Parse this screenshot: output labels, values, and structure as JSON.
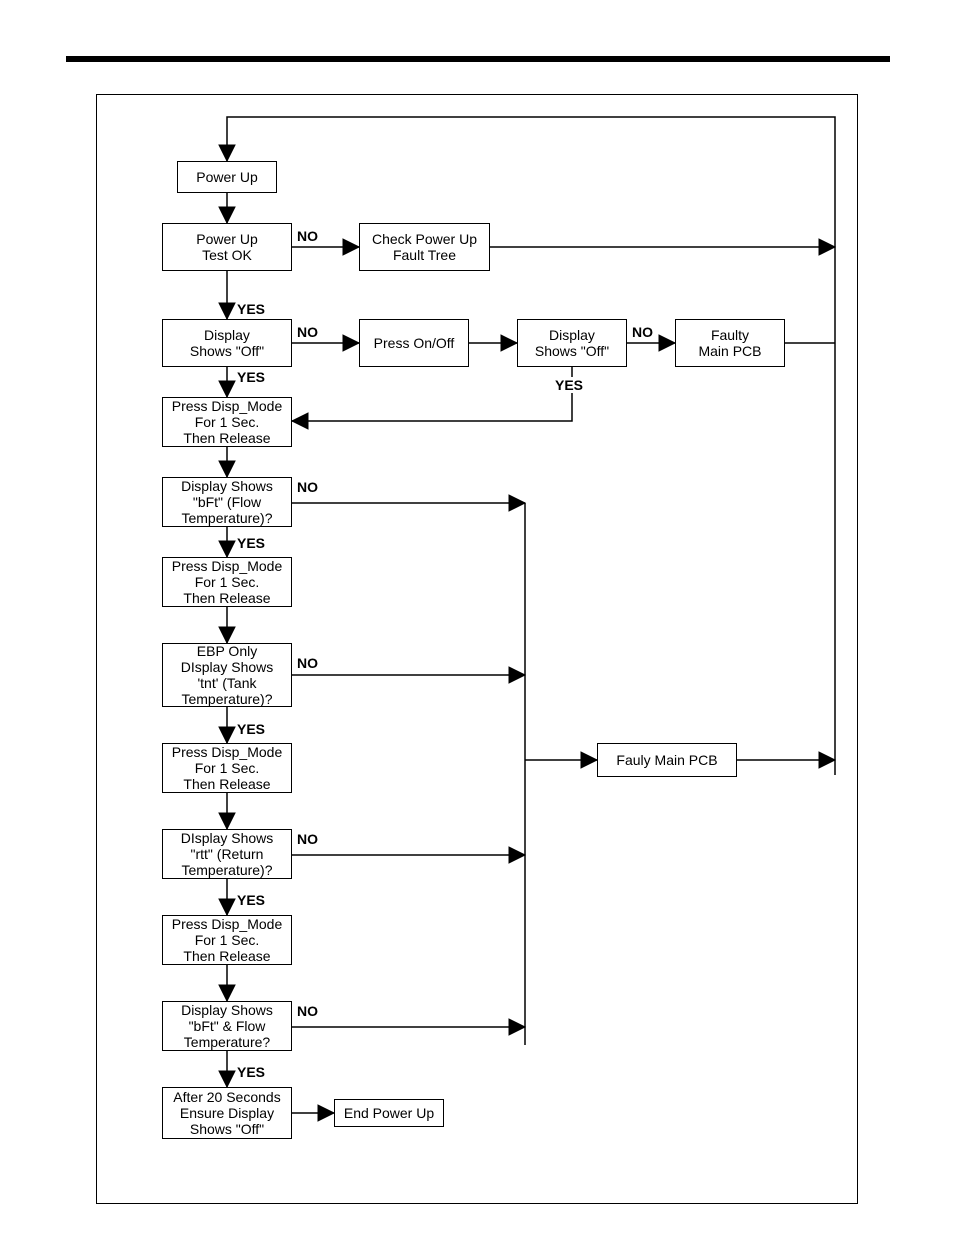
{
  "labels": {
    "yes": "YES",
    "no": "NO"
  },
  "nodes": {
    "power_up": "Power Up",
    "power_up_test": "Power Up\nTest OK",
    "check_fault_tree": "Check Power Up\nFault Tree",
    "display_off_1": "Display\nShows \"Off\"",
    "press_on_off": "Press On/Off",
    "display_off_2": "Display\nShows \"Off\"",
    "faulty_main_pcb": "Faulty\nMain PCB",
    "press_disp_1": "Press Disp_Mode\nFor 1 Sec.\nThen Release",
    "shows_bft": "Display Shows\n\"bFt\" (Flow\nTemperature)?",
    "press_disp_2": "Press Disp_Mode\nFor 1 Sec.\nThen Release",
    "shows_tnt": "EBP Only\nDIsplay Shows\n'tnt' (Tank\nTemperature)?",
    "press_disp_3": "Press Disp_Mode\nFor 1 Sec.\nThen Release",
    "fauly_main_pcb": "Fauly Main PCB",
    "shows_rtt": "DIsplay Shows\n\"rtt\" (Return\nTemperature)?",
    "press_disp_4": "Press Disp_Mode\nFor 1 Sec.\nThen Release",
    "shows_bft_flow": "Display Shows\n\"bFt\" & Flow\nTemperature?",
    "after_20s": "After 20 Seconds\nEnsure Display\nShows \"Off\"",
    "end_power_up": "End Power Up"
  }
}
